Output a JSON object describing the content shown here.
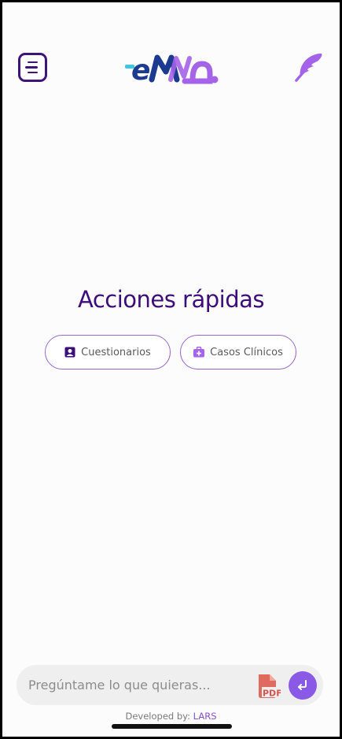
{
  "header": {
    "menu_icon": "menu-icon",
    "logo_text": "eMa",
    "feather_icon": "feather-icon"
  },
  "main": {
    "title": "Acciones rápidas",
    "quick_actions": [
      {
        "label": "Cuestionarios",
        "icon": "user-card-icon"
      },
      {
        "label": "Casos Clínicos",
        "icon": "medical-kit-icon"
      }
    ]
  },
  "chat": {
    "placeholder": "Pregúntame lo que quieras...",
    "pdf_label": "PDF",
    "send_icon": "enter-arrow-icon"
  },
  "footer": {
    "prefix": "Developed by:",
    "link": "LARS"
  },
  "colors": {
    "accent": "#8a5ae6",
    "title": "#3d0d7a",
    "logo_blue": "#1c3a8f",
    "logo_purple": "#a463e8",
    "pdf_red": "#d9534f"
  }
}
